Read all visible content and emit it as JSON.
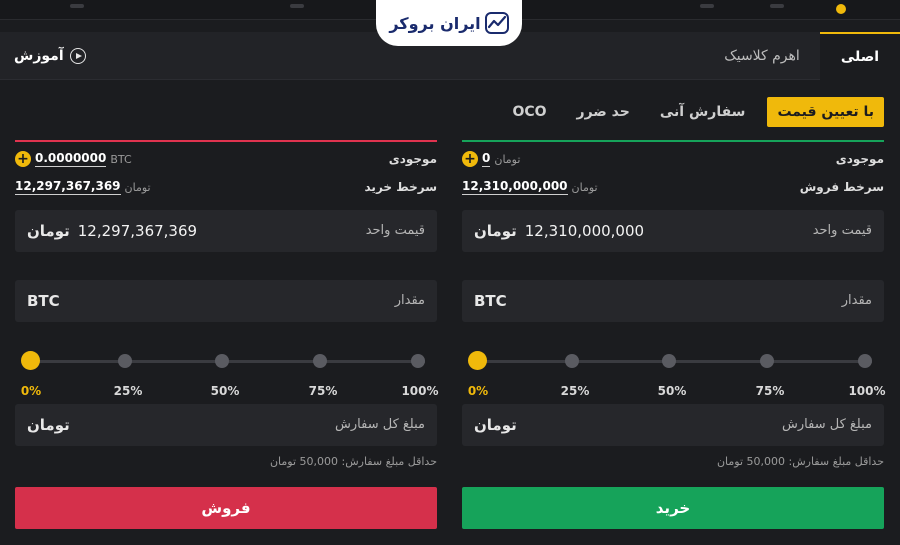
{
  "logo": {
    "text": "ایران بروکر"
  },
  "tabs": {
    "main": "اصلی",
    "leverage": "اهرم کلاسیک",
    "tutorial": "آموزش"
  },
  "order_types": {
    "limit": "با تعیین قیمت",
    "market": "سفارش آنی",
    "stop": "حد ضرر",
    "oco": "OCO",
    "active": "limit"
  },
  "buy": {
    "balance_label": "موجودی",
    "balance_value": "0",
    "balance_unit": "تومان",
    "rate_label": "سرخط فروش",
    "rate_value": "12,310,000,000",
    "rate_unit": "تومان",
    "price_label": "قیمت واحد",
    "price_value": "12,310,000,000",
    "price_unit": "تومان",
    "amount_label": "مقدار",
    "amount_unit": "BTC",
    "total_label": "مبلغ کل سفارش",
    "total_unit": "تومان",
    "min_note": "حداقل مبلغ سفارش: 50,000 تومان",
    "button": "خرید",
    "slider_percent": 0,
    "slider_labels": [
      "0%",
      "25%",
      "50%",
      "75%",
      "100%"
    ]
  },
  "sell": {
    "balance_label": "موجودی",
    "balance_value": "0.0000000",
    "balance_unit": "BTC",
    "rate_label": "سرخط خرید",
    "rate_value": "12,297,367,369",
    "rate_unit": "تومان",
    "price_label": "قیمت واحد",
    "price_value": "12,297,367,369",
    "price_unit": "تومان",
    "amount_label": "مقدار",
    "amount_unit": "BTC",
    "total_label": "مبلغ کل سفارش",
    "total_unit": "تومان",
    "min_note": "حداقل مبلغ سفارش: 50,000 تومان",
    "button": "فروش",
    "slider_percent": 0,
    "slider_labels": [
      "0%",
      "25%",
      "50%",
      "75%",
      "100%"
    ]
  },
  "colors": {
    "accent": "#f0b90b",
    "buy": "#16a35a",
    "sell": "#d5304b",
    "background": "#1b1c1f"
  }
}
